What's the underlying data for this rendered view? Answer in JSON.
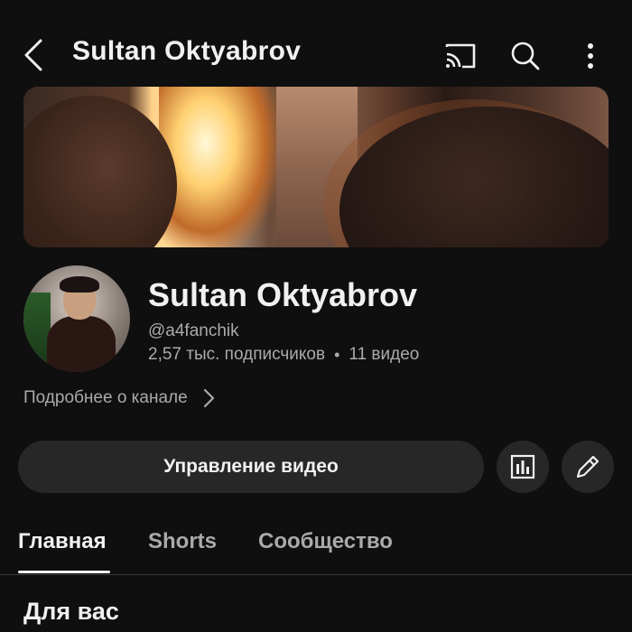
{
  "header": {
    "title": "Sultan Oktyabrov",
    "icons": [
      "back-arrow-icon",
      "cast-icon",
      "search-icon",
      "more-vert-icon"
    ]
  },
  "channel": {
    "name": "Sultan Oktyabrov",
    "handle": "@a4fanchik",
    "subscribers": "2,57 тыс. подписчиков",
    "separator": "•",
    "videos": "11 видео",
    "more_about": "Подробнее о канале"
  },
  "actions": {
    "manage_videos": "Управление видео",
    "icons": [
      "analytics-icon",
      "edit-pencil-icon"
    ]
  },
  "tabs": [
    {
      "label": "Главная",
      "active": true
    },
    {
      "label": "Shorts",
      "active": false
    },
    {
      "label": "Сообщество",
      "active": false
    }
  ],
  "section": {
    "title": "Для вас"
  },
  "colors": {
    "background": "#0f0f0f",
    "text_primary": "#f1f1f1",
    "text_secondary": "#aaaaaa",
    "button_bg": "#272727"
  }
}
